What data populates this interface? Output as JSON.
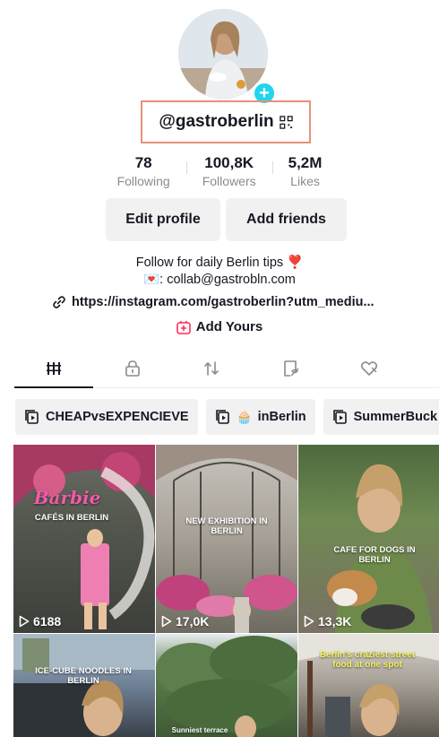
{
  "profile": {
    "username": "@gastroberlin",
    "plus_symbol": "+",
    "qr_icon": "qr-code-icon"
  },
  "stats": [
    {
      "value": "78",
      "label": "Following"
    },
    {
      "value": "100,8K",
      "label": "Followers"
    },
    {
      "value": "5,2M",
      "label": "Likes"
    }
  ],
  "actions": {
    "edit_profile": "Edit profile",
    "add_friends": "Add friends"
  },
  "bio": {
    "line1": "Follow for daily Berlin tips",
    "line1_emoji": "❣️",
    "line2_emoji": "💌",
    "line2": ": collab@gastrobln.com",
    "link": "https://instagram.com/gastroberlin?utm_mediu...",
    "add_yours": "Add Yours"
  },
  "tabs": [
    {
      "icon": "videos-grid-icon",
      "active": true
    },
    {
      "icon": "private-lock-icon",
      "active": false
    },
    {
      "icon": "reposts-icon",
      "active": false
    },
    {
      "icon": "favorites-icon",
      "active": false
    },
    {
      "icon": "liked-icon",
      "active": false
    }
  ],
  "playlists": [
    {
      "label": "CHEAPvsEXPENCIEVE",
      "emoji": ""
    },
    {
      "label": "inBerlin",
      "emoji": "🧁"
    },
    {
      "label": "SummerBuck",
      "emoji": ""
    }
  ],
  "videos": [
    {
      "views": "6188",
      "caption_top": "Barbie",
      "caption": "CAFÉS IN BERLIN"
    },
    {
      "views": "17,0K",
      "caption": "NEW EXHIBITION IN BERLIN"
    },
    {
      "views": "13,3K",
      "caption": "CAFE FOR DOGS IN BERLIN"
    },
    {
      "views": "",
      "caption": "ICE-CUBE NOODLES IN BERLIN"
    },
    {
      "views": "",
      "caption": "Sunniest terrace"
    },
    {
      "views": "",
      "caption": "Berlin's craziest street food at one spot"
    }
  ],
  "colors": {
    "accent_cyan": "#20d5ec",
    "add_yours_red": "#fe2c55",
    "text_primary": "#161823",
    "text_secondary": "#8a8b91",
    "button_bg": "#f1f1f2",
    "highlight_border": "#e8907a"
  }
}
